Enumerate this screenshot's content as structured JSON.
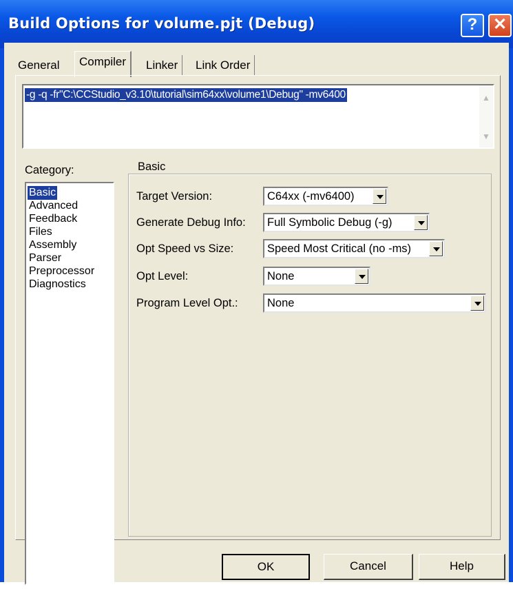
{
  "window": {
    "title": "Build Options for volume.pjt (Debug)",
    "help_glyph": "?",
    "close_glyph": "✕"
  },
  "tabs": [
    {
      "label": "General"
    },
    {
      "label": "Compiler"
    },
    {
      "label": "Linker"
    },
    {
      "label": "Link Order"
    }
  ],
  "command_line": "-g -q -fr\"C:\\CCStudio_v3.10\\tutorial\\sim64xx\\volume1\\Debug\" -mv6400",
  "category": {
    "label": "Category:",
    "items": [
      "Basic",
      "Advanced",
      "Feedback",
      "Files",
      "Assembly",
      "Parser",
      "Preprocessor",
      "Diagnostics"
    ],
    "selected": "Basic"
  },
  "basic": {
    "group_label": "Basic",
    "fields": [
      {
        "label": "Target Version:",
        "value": "C64xx (-mv6400)"
      },
      {
        "label": "Generate Debug Info:",
        "value": "Full Symbolic Debug (-g)"
      },
      {
        "label": "Opt Speed vs Size:",
        "value": "Speed Most Critical (no -ms)"
      },
      {
        "label": "Opt Level:",
        "value": "None"
      },
      {
        "label": "Program Level Opt.:",
        "value": "None"
      }
    ]
  },
  "buttons": {
    "ok": "OK",
    "cancel": "Cancel",
    "help": "Help"
  },
  "colors": {
    "titlebar": "#0a58e6",
    "dialog_bg": "#ece9d8",
    "selection": "#1d3e9c"
  }
}
